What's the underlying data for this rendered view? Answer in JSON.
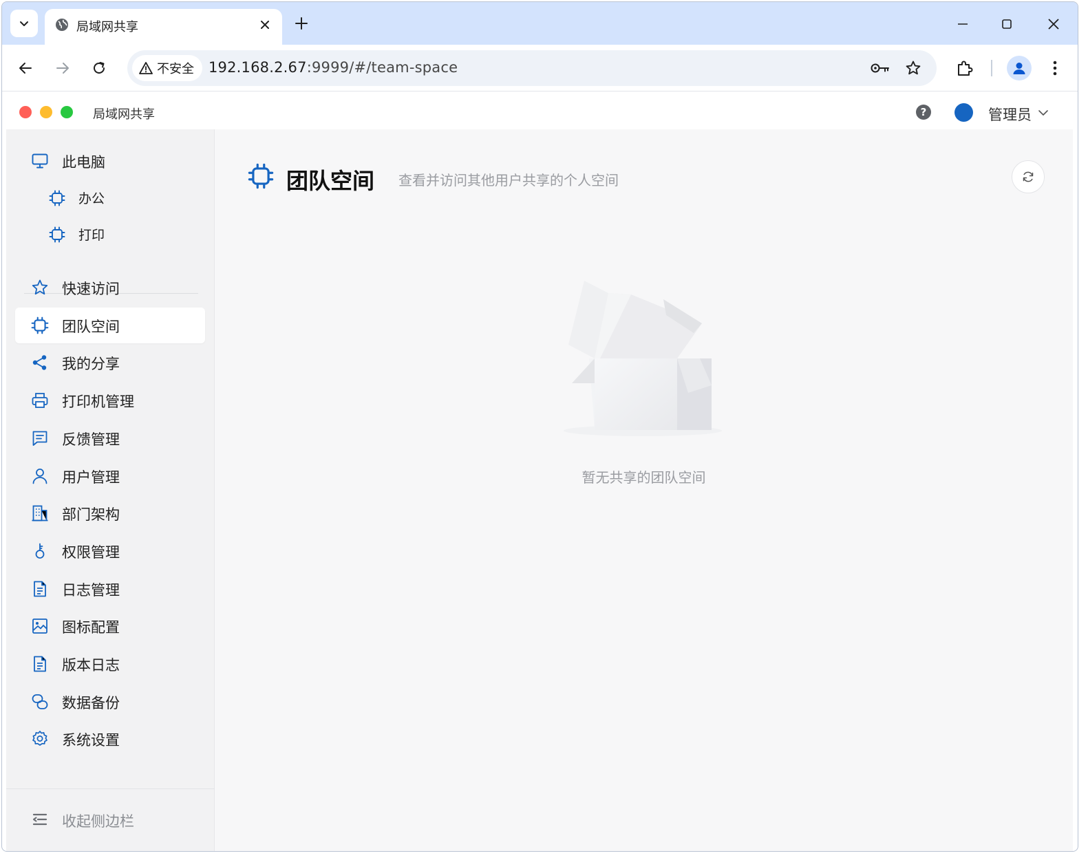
{
  "browser": {
    "tab": {
      "title": "局域网共享"
    },
    "address": {
      "security_label": "不安全",
      "url_host": "192.168.2.67",
      "url_rest": ":9999/#/team-space"
    }
  },
  "app": {
    "title": "局域网共享",
    "traffic_lights": [
      "#ff5f57",
      "#febc2e",
      "#28c840"
    ],
    "user": {
      "name": "管理员",
      "avatar_color": "#1665c1"
    }
  },
  "sidebar": {
    "computer": {
      "label": "此电脑",
      "children": [
        {
          "label": "办公"
        },
        {
          "label": "打印"
        }
      ]
    },
    "items": [
      {
        "label": "快速访问",
        "icon": "star-icon"
      },
      {
        "label": "团队空间",
        "icon": "chip-icon",
        "active": true
      },
      {
        "label": "我的分享",
        "icon": "share-icon"
      },
      {
        "label": "打印机管理",
        "icon": "printer-icon"
      },
      {
        "label": "反馈管理",
        "icon": "message-icon"
      },
      {
        "label": "用户管理",
        "icon": "user-icon"
      },
      {
        "label": "部门架构",
        "icon": "building-icon"
      },
      {
        "label": "权限管理",
        "icon": "key-icon"
      },
      {
        "label": "日志管理",
        "icon": "document-icon"
      },
      {
        "label": "图标配置",
        "icon": "image-icon"
      },
      {
        "label": "版本日志",
        "icon": "document-icon"
      },
      {
        "label": "数据备份",
        "icon": "backup-icon"
      },
      {
        "label": "系统设置",
        "icon": "gear-icon"
      }
    ],
    "collapse_label": "收起侧边栏"
  },
  "main": {
    "title": "团队空间",
    "subtitle": "查看并访问其他用户共享的个人空间",
    "empty_text": "暂无共享的团队空间"
  },
  "colors": {
    "accent": "#1665c1"
  }
}
